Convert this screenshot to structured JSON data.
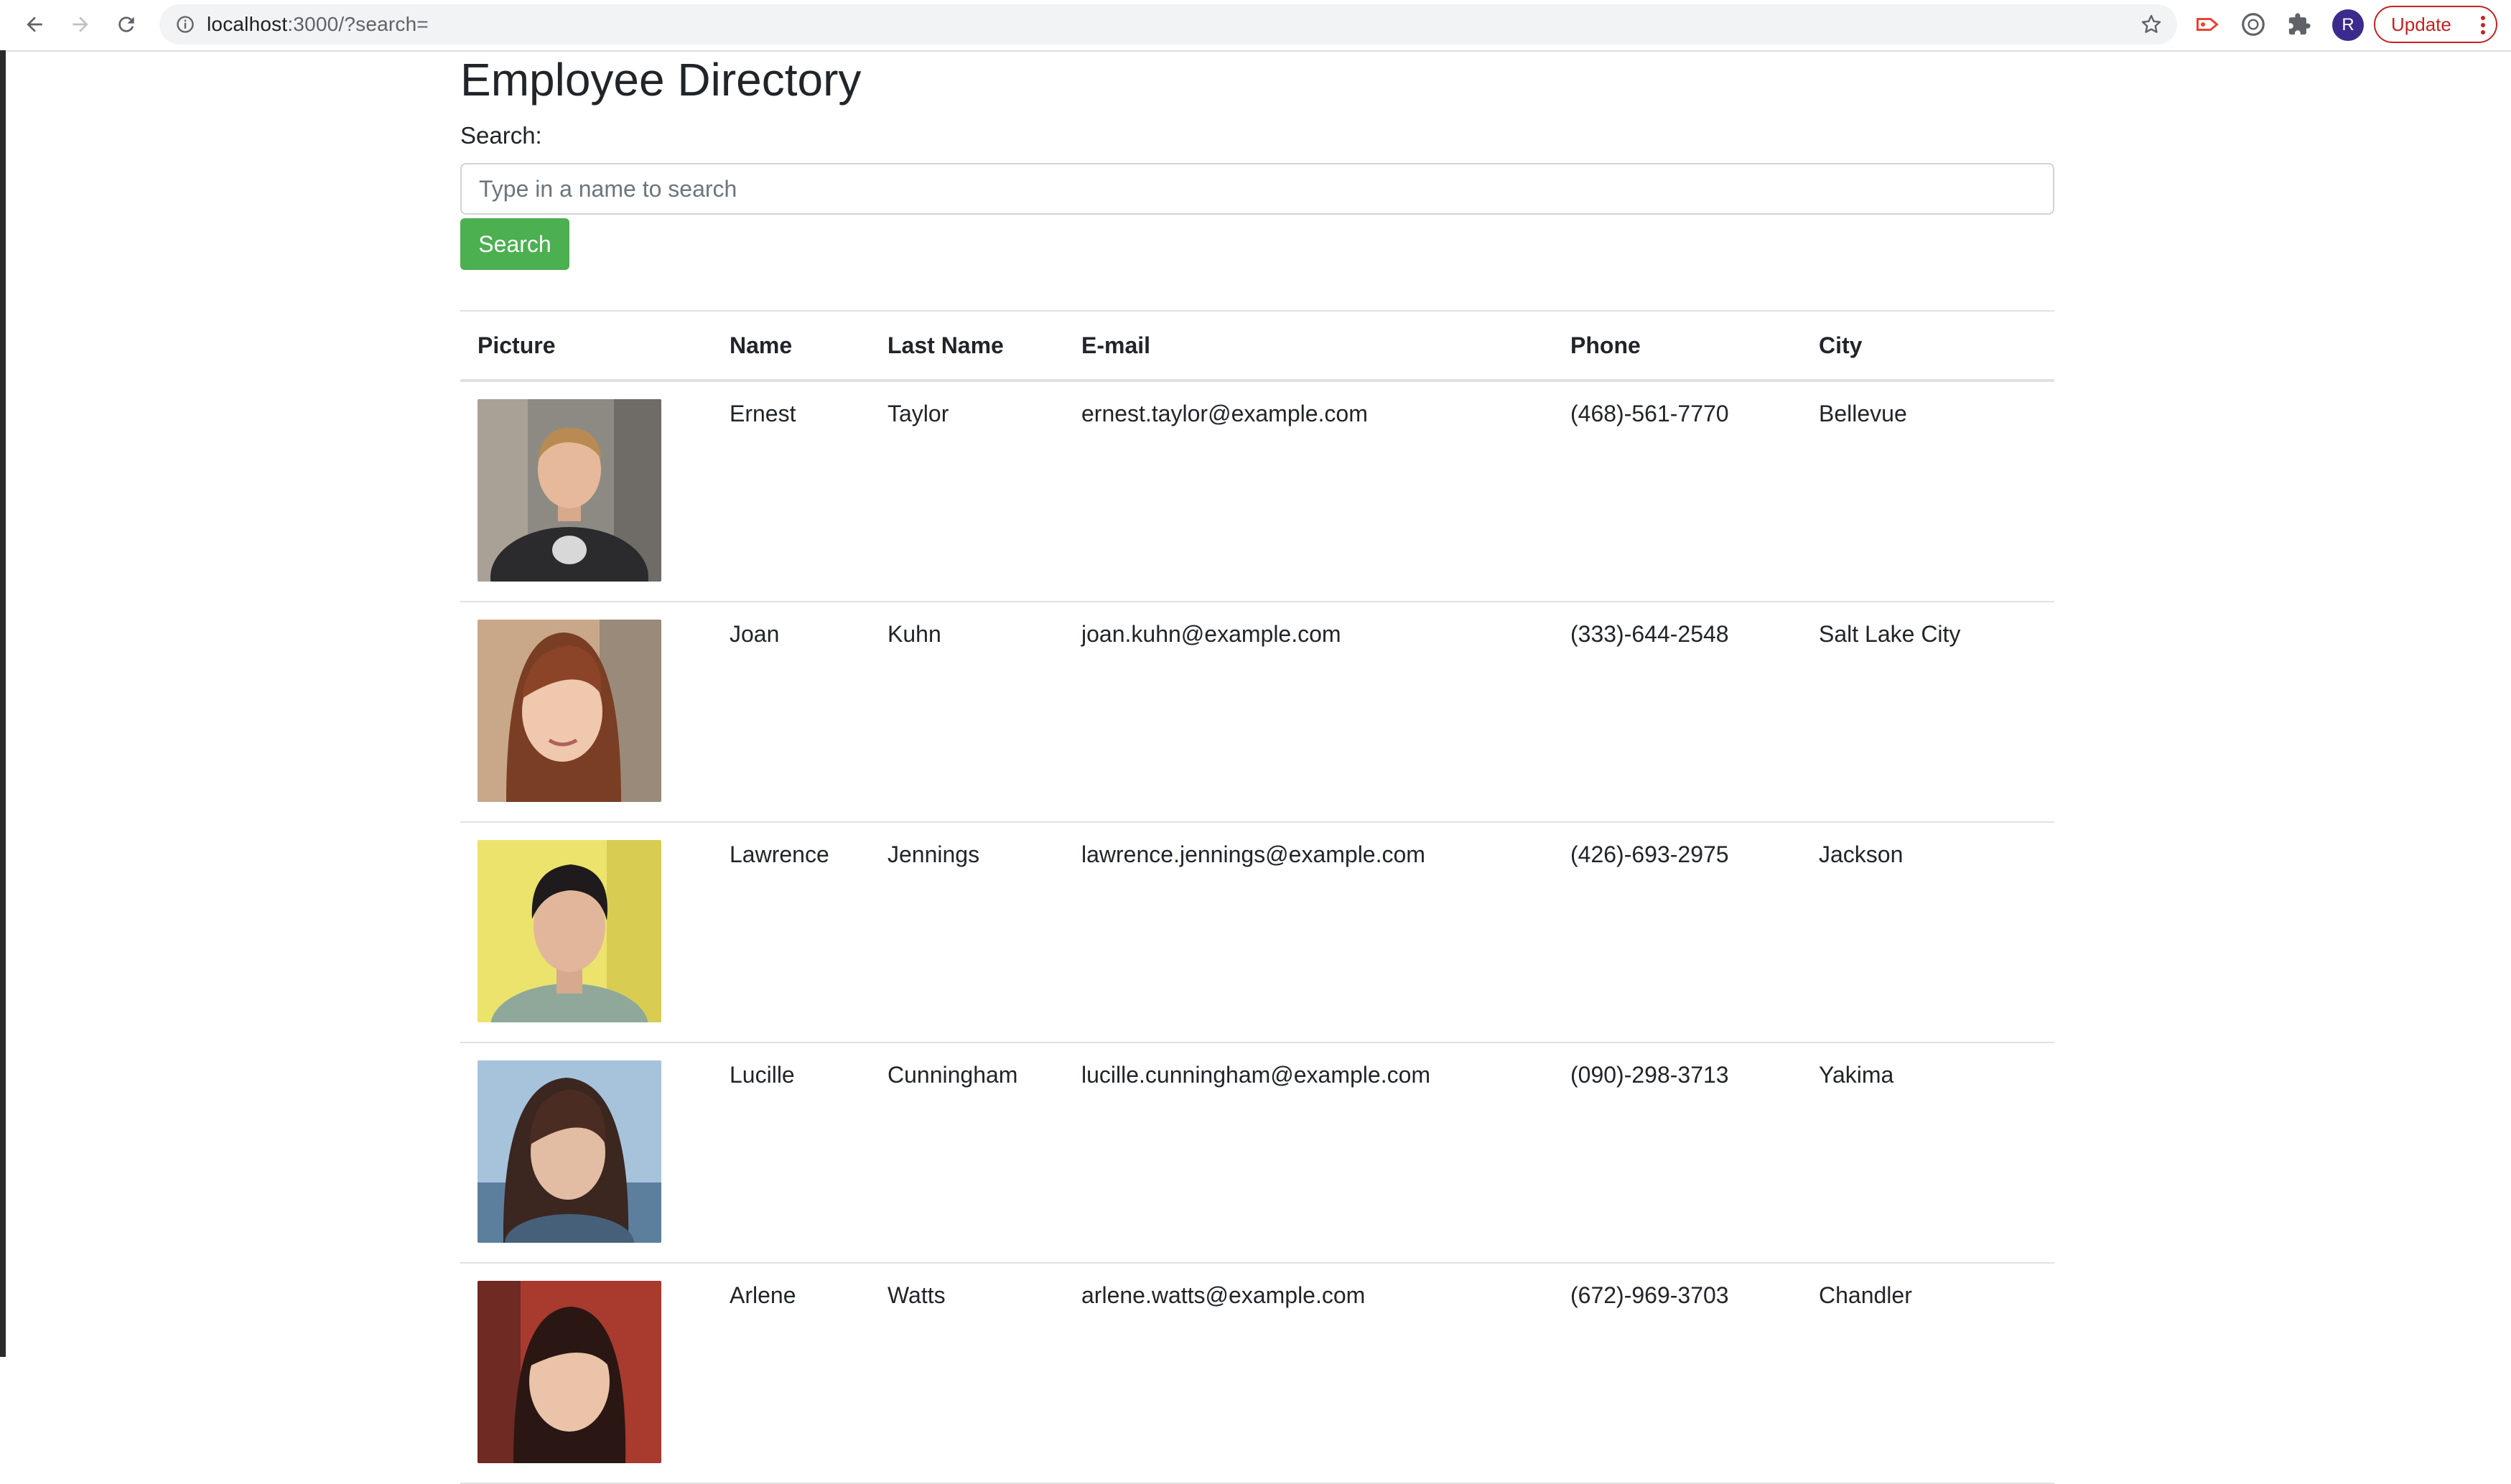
{
  "browser": {
    "url_host": "localhost",
    "url_rest": ":3000/?search=",
    "profile_initial": "R",
    "update_label": "Update"
  },
  "page": {
    "title": "Employee Directory",
    "search_label": "Search:",
    "search_placeholder": "Type in a name to search",
    "search_value": "",
    "search_button": "Search"
  },
  "table": {
    "headers": [
      "Picture",
      "Name",
      "Last Name",
      "E-mail",
      "Phone",
      "City"
    ],
    "rows": [
      {
        "first": "Ernest",
        "last": "Taylor",
        "email": "ernest.taylor@example.com",
        "phone": "(468)-561-7770",
        "city": "Bellevue"
      },
      {
        "first": "Joan",
        "last": "Kuhn",
        "email": "joan.kuhn@example.com",
        "phone": "(333)-644-2548",
        "city": "Salt Lake City"
      },
      {
        "first": "Lawrence",
        "last": "Jennings",
        "email": "lawrence.jennings@example.com",
        "phone": "(426)-693-2975",
        "city": "Jackson"
      },
      {
        "first": "Lucille",
        "last": "Cunningham",
        "email": "lucille.cunningham@example.com",
        "phone": "(090)-298-3713",
        "city": "Yakima"
      },
      {
        "first": "Arlene",
        "last": "Watts",
        "email": "arlene.watts@example.com",
        "phone": "(672)-969-3703",
        "city": "Chandler"
      }
    ]
  },
  "colors": {
    "search_button": "#4caf50",
    "update_accent": "#c5221f",
    "avatar": "#3c2a8c"
  }
}
